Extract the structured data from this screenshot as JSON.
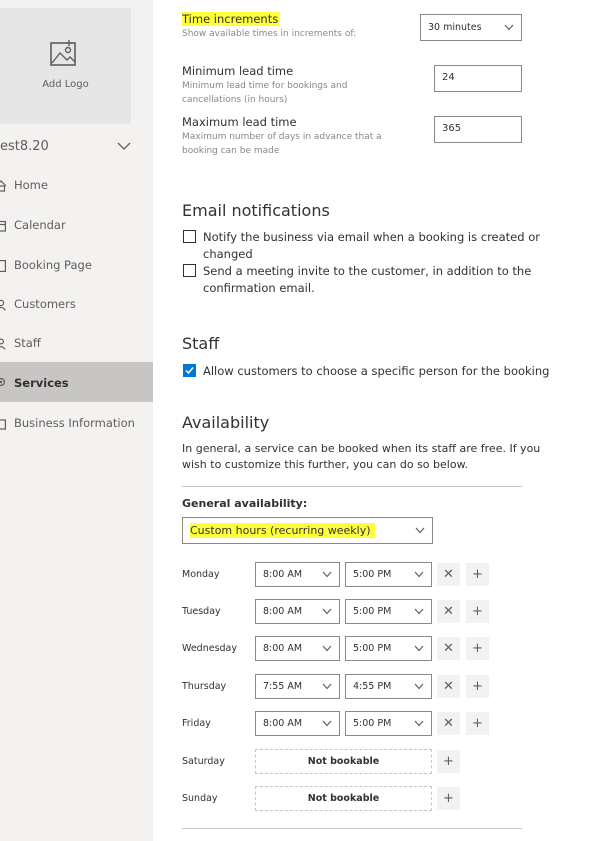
{
  "sidebar": {
    "logo_label": "Add Logo",
    "business_name": "est8.20",
    "nav": [
      {
        "label": "Home",
        "icon": "home-icon"
      },
      {
        "label": "Calendar",
        "icon": "calendar-icon"
      },
      {
        "label": "Booking Page",
        "icon": "booking-page-icon"
      },
      {
        "label": "Customers",
        "icon": "customers-icon"
      },
      {
        "label": "Staff",
        "icon": "staff-icon"
      },
      {
        "label": "Services",
        "icon": "services-icon",
        "active": true
      },
      {
        "label": "Business Information",
        "icon": "business-info-icon"
      }
    ]
  },
  "scheduling": {
    "time_increments": {
      "label": "Time increments",
      "hint": "Show available times in increments of:",
      "value": "30 minutes"
    },
    "min_lead": {
      "label": "Minimum lead time",
      "hint_line1": "Minimum lead time for bookings and",
      "hint_line2": "cancellations (in hours)",
      "value": "24"
    },
    "max_lead": {
      "label": "Maximum lead time",
      "hint_line1": "Maximum number of days in advance that a",
      "hint_line2": "booking can be made",
      "value": "365"
    }
  },
  "email": {
    "title": "Email notifications",
    "notify_line1": "Notify the business via email when a booking is created or",
    "notify_line2": "changed",
    "notify_checked": false,
    "invite_line1": "Send a meeting invite to the customer, in addition to the",
    "invite_line2": "confirmation email.",
    "invite_checked": false
  },
  "staff": {
    "title": "Staff",
    "allow_choose": "Allow customers to choose a specific person for the booking",
    "allow_checked": true
  },
  "availability": {
    "title": "Availability",
    "desc_line1": "In general, a service can be booked when its staff are free. If you",
    "desc_line2": "wish to customize this further, you can do so below.",
    "general_label": "General availability:",
    "general_value": "Custom hours (recurring weekly)",
    "days": [
      {
        "day": "Monday",
        "start": "8:00 AM",
        "end": "5:00 PM"
      },
      {
        "day": "Tuesday",
        "start": "8:00 AM",
        "end": "5:00 PM"
      },
      {
        "day": "Wednesday",
        "start": "8:00 AM",
        "end": "5:00 PM"
      },
      {
        "day": "Thursday",
        "start": "7:55 AM",
        "end": "4:55 PM"
      },
      {
        "day": "Friday",
        "start": "8:00 AM",
        "end": "5:00 PM"
      },
      {
        "day": "Saturday",
        "status": "Not bookable"
      },
      {
        "day": "Sunday",
        "status": "Not bookable"
      }
    ],
    "remove_glyph": "✕",
    "add_glyph": "+"
  },
  "colors": {
    "highlight": "#ffff3c",
    "accent": "#0078d4",
    "active_nav": "#c8c6c4"
  }
}
